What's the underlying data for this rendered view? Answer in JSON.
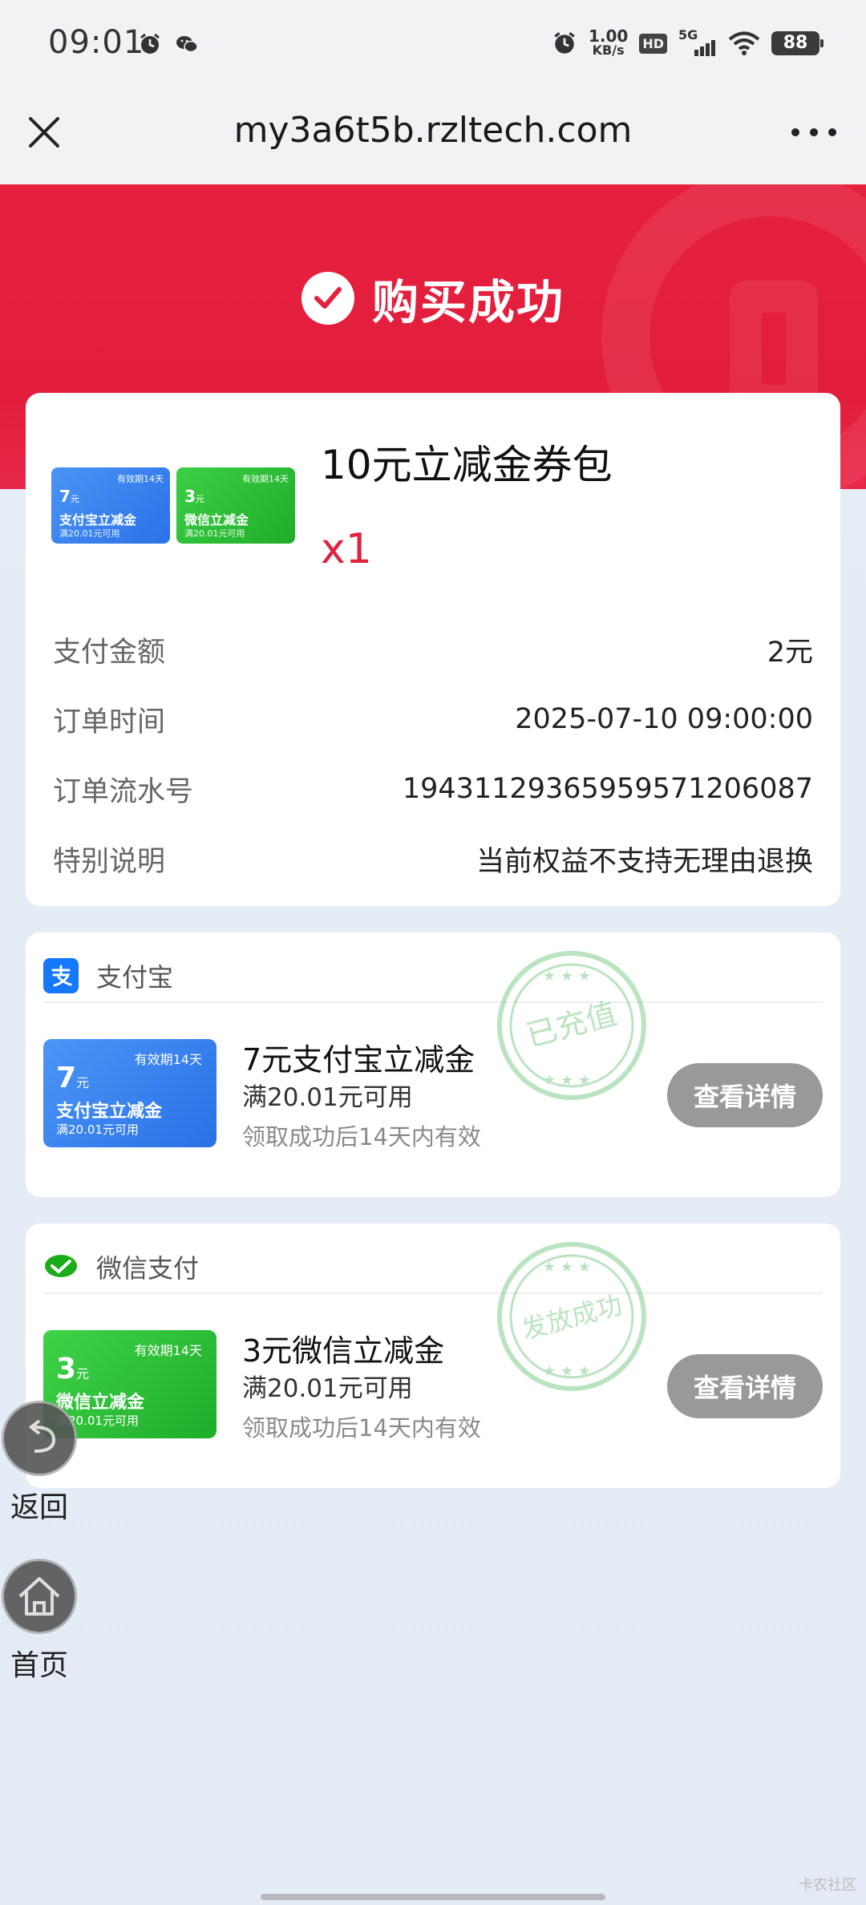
{
  "status_bar": {
    "time": "09:01",
    "net_speed_value": "1.00",
    "net_speed_unit": "KB/s",
    "hd": "HD",
    "network": "5G",
    "battery": "88"
  },
  "title_bar": {
    "url": "my3a6t5b.rzltech.com"
  },
  "banner": {
    "title": "购买成功",
    "color": "#e5213f"
  },
  "order": {
    "product_title": "10元立减金券包",
    "quantity": "x1",
    "mini_coupons": [
      {
        "valid": "有效期14天",
        "amount": "7",
        "unit": "元",
        "name": "支付宝立减金",
        "condition": "满20.01元可用"
      },
      {
        "valid": "有效期14天",
        "amount": "3",
        "unit": "元",
        "name": "微信立减金",
        "condition": "满20.01元可用"
      }
    ],
    "rows": [
      {
        "label": "支付金额",
        "value": "2元"
      },
      {
        "label": "订单时间",
        "value": "2025-07-10 09:00:00"
      },
      {
        "label": "订单流水号",
        "value": "1943112936595957120608​7"
      },
      {
        "label": "特别说明",
        "value": "当前权益不支持无理由退换"
      }
    ]
  },
  "vouchers": [
    {
      "provider": "支付宝",
      "coupon_valid": "有效期14天",
      "coupon_amount": "7",
      "coupon_unit": "元",
      "coupon_name": "支付宝立减金",
      "coupon_condition": "满20.01元可用",
      "title": "7元支付宝立减金",
      "condition": "满20.01元可用",
      "note": "领取成功后14天内有效",
      "button": "查看详情",
      "stamp": "已充值"
    },
    {
      "provider": "微信支付",
      "coupon_valid": "有效期14天",
      "coupon_amount": "3",
      "coupon_unit": "元",
      "coupon_name": "微信立减金",
      "coupon_condition": "满20.01元可用",
      "title": "3元微信立减金",
      "condition": "满20.01元可用",
      "note": "领取成功后14天内有效",
      "button": "查看详情",
      "stamp": "发放成功"
    }
  ],
  "floating_nav": {
    "back_label": "返回",
    "home_label": "首页"
  },
  "watermark": "卡农社区"
}
